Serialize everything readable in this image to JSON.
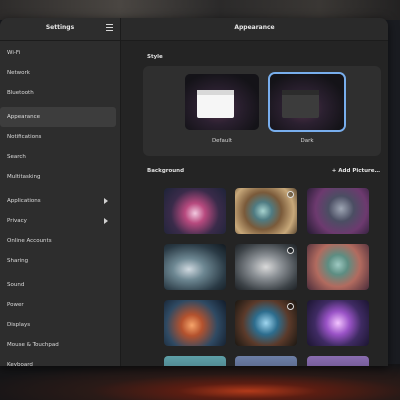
{
  "sidebar": {
    "title": "Settings",
    "items": [
      {
        "label": "Wi-Fi"
      },
      {
        "label": "Network"
      },
      {
        "label": "Bluetooth"
      },
      {
        "label": "Appearance",
        "active": true
      },
      {
        "label": "Notifications"
      },
      {
        "label": "Search"
      },
      {
        "label": "Multitasking"
      },
      {
        "label": "Applications",
        "has_submenu": true
      },
      {
        "label": "Privacy",
        "has_submenu": true
      },
      {
        "label": "Online Accounts"
      },
      {
        "label": "Sharing"
      },
      {
        "label": "Sound"
      },
      {
        "label": "Power"
      },
      {
        "label": "Displays"
      },
      {
        "label": "Mouse & Touchpad"
      },
      {
        "label": "Keyboard"
      }
    ]
  },
  "main": {
    "title": "Appearance",
    "style": {
      "label": "Style",
      "options": [
        {
          "label": "Default",
          "selected": false
        },
        {
          "label": "Dark",
          "selected": true
        }
      ]
    },
    "background": {
      "label": "Background",
      "add_label": "+ Add Picture…",
      "wallpapers": [
        {
          "name": "wallpaper-1"
        },
        {
          "name": "wallpaper-2"
        },
        {
          "name": "wallpaper-3"
        },
        {
          "name": "wallpaper-4"
        },
        {
          "name": "wallpaper-5"
        },
        {
          "name": "wallpaper-6"
        },
        {
          "name": "wallpaper-7"
        },
        {
          "name": "wallpaper-8"
        },
        {
          "name": "wallpaper-9"
        },
        {
          "name": "wallpaper-10"
        },
        {
          "name": "wallpaper-11"
        },
        {
          "name": "wallpaper-12"
        }
      ]
    }
  },
  "colors": {
    "accent": "#78aeed",
    "sidebar_bg": "#2d2d2d",
    "main_bg": "#242424",
    "active_item_bg": "#3d3d3d"
  }
}
